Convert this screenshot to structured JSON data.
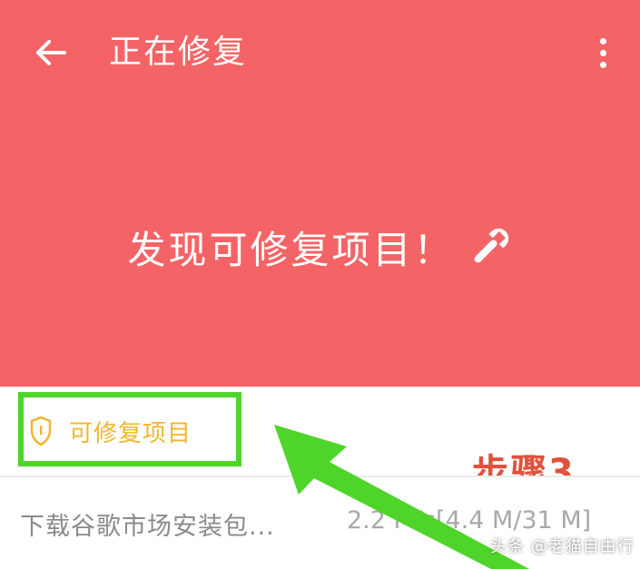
{
  "toolbar": {
    "title": "正在修复",
    "back_icon": "arrow-left-icon",
    "menu_icon": "more-vertical-icon"
  },
  "hero": {
    "message": "发现可修复项目！",
    "icon": "wrench-icon",
    "background_color": "#f46466"
  },
  "section": {
    "label": "可修复项目",
    "icon": "shield-icon",
    "label_color": "#f3b52b"
  },
  "annotation": {
    "step_label": "步骤3",
    "highlight_color": "#4fd42a",
    "step_color": "#e1513c"
  },
  "list": {
    "items": [
      {
        "name": "下载谷歌市场安装包...",
        "progress": "2.2 M/s[4.4 M/31 M]"
      }
    ]
  },
  "watermark": {
    "text": "头条 @老猫自由行"
  }
}
